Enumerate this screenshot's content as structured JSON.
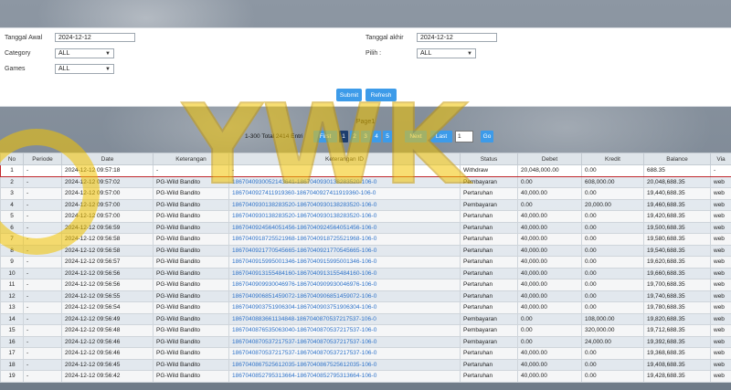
{
  "filters": {
    "tanggal_awal_label": "Tanggal Awal",
    "tanggal_awal_value": "2024-12-12",
    "tanggal_akhir_label": "Tanggal akhir",
    "tanggal_akhir_value": "2024-12-12",
    "category_label": "Category",
    "category_value": "ALL",
    "pilih_label": "Pilih :",
    "pilih_value": "ALL",
    "games_label": "Games",
    "games_value": "ALL",
    "submit_label": "Submit",
    "refresh_label": "Refresh"
  },
  "pager": {
    "title": "Page1",
    "info": "1-300 Total 2414 Entri",
    "first": "First",
    "pages": [
      "1",
      "2",
      "3",
      "4",
      "5"
    ],
    "next": "Next",
    "last": "Last",
    "input_value": "1",
    "go": "Go"
  },
  "table": {
    "headers": [
      "No",
      "Periode",
      "Date",
      "Keterangan",
      "Keterangan ID",
      "Status",
      "Debet",
      "Kredit",
      "Balance",
      "Via"
    ],
    "rows": [
      [
        "1",
        "-",
        "2024-12-12 09:57:18",
        "-",
        "-",
        "Withdraw",
        "20,048,000.00",
        "0.00",
        "688.35",
        "-"
      ],
      [
        "2",
        "-",
        "2024-12-12 09:57:02",
        "PG-Wild Bandito",
        "1867040930052143641-1867040930138283520-106-0",
        "Pembayaran",
        "0.00",
        "608,000.00",
        "20,048,688.35",
        "web"
      ],
      [
        "3",
        "-",
        "2024-12-12 09:57:00",
        "PG-Wild Bandito",
        "1867040927411919360-1867040927411919360-106-0",
        "Pertaruhan",
        "40,000.00",
        "0.00",
        "19,440,688.35",
        "web"
      ],
      [
        "4",
        "-",
        "2024-12-12 09:57:00",
        "PG-Wild Bandito",
        "1867040930138283520-1867040930138283520-106-0",
        "Pembayaran",
        "0.00",
        "20,000.00",
        "19,460,688.35",
        "web"
      ],
      [
        "5",
        "-",
        "2024-12-12 09:57:00",
        "PG-Wild Bandito",
        "1867040930138283520-1867040930138283520-106-0",
        "Pertaruhan",
        "40,000.00",
        "0.00",
        "19,420,688.35",
        "web"
      ],
      [
        "6",
        "-",
        "2024-12-12 09:56:59",
        "PG-Wild Bandito",
        "1867040924564051456-1867040924564051456-106-0",
        "Pertaruhan",
        "40,000.00",
        "0.00",
        "19,500,688.35",
        "web"
      ],
      [
        "7",
        "-",
        "2024-12-12 09:56:58",
        "PG-Wild Bandito",
        "1867040918725521968-1867040918725521968-106-0",
        "Pertaruhan",
        "40,000.00",
        "0.00",
        "19,580,688.35",
        "web"
      ],
      [
        "8",
        "-",
        "2024-12-12 09:56:58",
        "PG-Wild Bandito",
        "1867040921770545665-1867040921770545665-106-0",
        "Pertaruhan",
        "40,000.00",
        "0.00",
        "19,540,688.35",
        "web"
      ],
      [
        "9",
        "-",
        "2024-12-12 09:56:57",
        "PG-Wild Bandito",
        "1867040915995001346-1867040915995001346-106-0",
        "Pertaruhan",
        "40,000.00",
        "0.00",
        "19,620,688.35",
        "web"
      ],
      [
        "10",
        "-",
        "2024-12-12 09:56:56",
        "PG-Wild Bandito",
        "1867040913155484160-1867040913155484160-106-0",
        "Pertaruhan",
        "40,000.00",
        "0.00",
        "19,660,688.35",
        "web"
      ],
      [
        "11",
        "-",
        "2024-12-12 09:56:56",
        "PG-Wild Bandito",
        "1867040909930046976-1867040909930046976-106-0",
        "Pertaruhan",
        "40,000.00",
        "0.00",
        "19,700,688.35",
        "web"
      ],
      [
        "12",
        "-",
        "2024-12-12 09:56:55",
        "PG-Wild Bandito",
        "1867040906851459072-1867040906851459072-106-0",
        "Pertaruhan",
        "40,000.00",
        "0.00",
        "19,740,688.35",
        "web"
      ],
      [
        "13",
        "-",
        "2024-12-12 09:56:54",
        "PG-Wild Bandito",
        "1867040903751906304-1867040903751906304-106-0",
        "Pertaruhan",
        "40,000.00",
        "0.00",
        "19,780,688.35",
        "web"
      ],
      [
        "14",
        "-",
        "2024-12-12 09:56:49",
        "PG-Wild Bandito",
        "1867040883661134848-1867040870537217537-106-0",
        "Pembayaran",
        "0.00",
        "108,000.00",
        "19,820,688.35",
        "web"
      ],
      [
        "15",
        "-",
        "2024-12-12 09:56:48",
        "PG-Wild Bandito",
        "1867040876535063040-1867040870537217537-106-0",
        "Pembayaran",
        "0.00",
        "320,000.00",
        "19,712,688.35",
        "web"
      ],
      [
        "16",
        "-",
        "2024-12-12 09:56:46",
        "PG-Wild Bandito",
        "1867040870537217537-1867040870537217537-106-0",
        "Pembayaran",
        "0.00",
        "24,000.00",
        "19,392,688.35",
        "web"
      ],
      [
        "17",
        "-",
        "2024-12-12 09:56:46",
        "PG-Wild Bandito",
        "1867040870537217537-1867040870537217537-106-0",
        "Pertaruhan",
        "40,000.00",
        "0.00",
        "19,368,688.35",
        "web"
      ],
      [
        "18",
        "-",
        "2024-12-12 09:56:45",
        "PG-Wild Bandito",
        "1867040867525612035-1867040867525612035-106-0",
        "Pertaruhan",
        "40,000.00",
        "0.00",
        "19,408,688.35",
        "web"
      ],
      [
        "19",
        "-",
        "2024-12-12 09:56:42",
        "PG-Wild Bandito",
        "1867040852795313664-1867040852795313664-106-0",
        "Pertaruhan",
        "40,000.00",
        "0.00",
        "19,428,688.35",
        "web"
      ]
    ]
  },
  "colors": {
    "button_blue": "#3d9be9",
    "active_page": "#1d3e6e",
    "link": "#2f73c9",
    "highlight_border": "#c0282d"
  },
  "watermark": {
    "text": "YWK"
  }
}
